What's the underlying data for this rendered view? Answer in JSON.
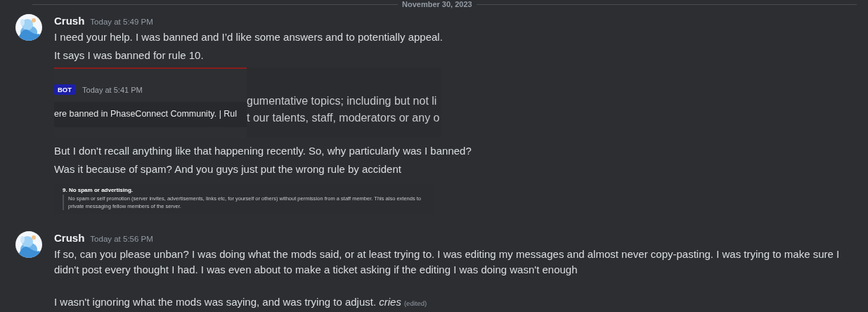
{
  "date_divider": "November 30, 2023",
  "messages": [
    {
      "author": "Crush",
      "time": "Today at 5:49 PM",
      "blocks": [
        {
          "kind": "text",
          "text": "I need your help. I was banned and I’d like some answers and to potentially appeal."
        },
        {
          "kind": "text",
          "text": "It says I was banned for rule 10."
        },
        {
          "kind": "screenshot",
          "badge": "BOT",
          "time": "Today at 5:41 PM",
          "left_text": "ere banned in PhaseConnect Community. | Rul",
          "right_lines": [
            "gumentative topics; including but not li",
            "t our talents, staff, moderators or any o"
          ]
        },
        {
          "kind": "text",
          "text": "But I don't recall anything like that happening recently. So, why particularly was I banned?"
        },
        {
          "kind": "text",
          "text": "Was it because of spam? And you guys just put the wrong rule by accident"
        },
        {
          "kind": "rule_image",
          "heading": "9. No spam or advertising.",
          "body": "No spam or self promotion (server invites, advertisements, links etc, for yourself or others) without permission from a staff member. This also extends to private messaging fellow members of the server."
        }
      ]
    },
    {
      "author": "Crush",
      "time": "Today at 5:56 PM",
      "blocks": [
        {
          "kind": "text",
          "text": "If so, can you please unban? I was doing what the mods said, or at least trying to. I was editing my messages and almost never copy-pasting. I was trying to make sure I didn't post every thought I had. I was even about to make a ticket asking if the editing I was doing wasn't enough"
        },
        {
          "kind": "gap"
        },
        {
          "kind": "text",
          "text": "I wasn't ignoring what the mods was saying, and was trying to adjust. *cries*",
          "edited": "(edited)"
        }
      ]
    }
  ]
}
